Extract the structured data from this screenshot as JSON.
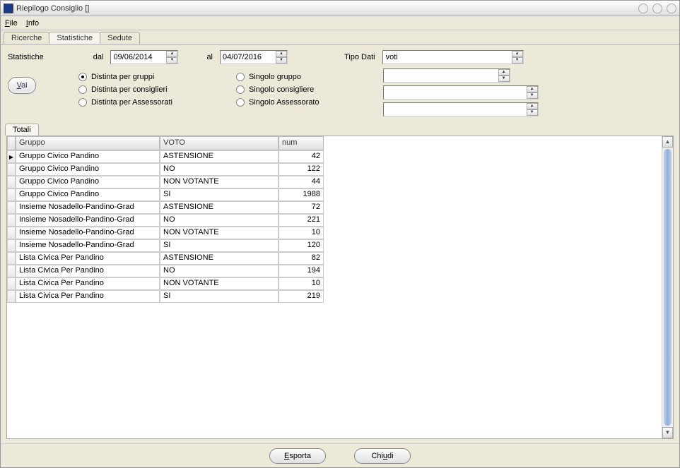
{
  "window": {
    "title": "Riepilogo Consiglio []"
  },
  "menu": {
    "file": "File",
    "info": "Info"
  },
  "mainTabs": {
    "ricerche": "Ricerche",
    "statistiche": "Statistiche",
    "sedute": "Sedute"
  },
  "filters": {
    "statLabel": "Statistiche",
    "dal": "dal",
    "dalValue": "09/06/2014",
    "al": "al",
    "alValue": "04/07/2016",
    "tipoDati": "Tipo Dati",
    "tipoDatiValue": "voti",
    "vai": "Vai",
    "radios": {
      "distGruppi": "Distinta per gruppi",
      "distCons": "Distinta per consiglieri",
      "distAss": "Distinta per Assessorati",
      "singGruppo": "Singolo gruppo",
      "singCons": "Singolo consigliere",
      "singAss": "Singolo Assessorato"
    }
  },
  "subTab": {
    "totali": "Totali"
  },
  "grid": {
    "headers": {
      "gruppo": "Gruppo",
      "voto": "VOTO",
      "num": "num"
    },
    "rows": [
      {
        "gruppo": "Gruppo Civico Pandino",
        "voto": "ASTENSIONE",
        "num": "42",
        "current": true
      },
      {
        "gruppo": "Gruppo Civico Pandino",
        "voto": "NO",
        "num": "122"
      },
      {
        "gruppo": "Gruppo Civico Pandino",
        "voto": "NON VOTANTE",
        "num": "44"
      },
      {
        "gruppo": "Gruppo Civico Pandino",
        "voto": "SI",
        "num": "1988"
      },
      {
        "gruppo": "Insieme Nosadello-Pandino-Grad",
        "voto": "ASTENSIONE",
        "num": "72"
      },
      {
        "gruppo": "Insieme Nosadello-Pandino-Grad",
        "voto": "NO",
        "num": "221"
      },
      {
        "gruppo": "Insieme Nosadello-Pandino-Grad",
        "voto": "NON VOTANTE",
        "num": "10"
      },
      {
        "gruppo": "Insieme Nosadello-Pandino-Grad",
        "voto": "SI",
        "num": "120"
      },
      {
        "gruppo": "Lista Civica Per Pandino",
        "voto": "ASTENSIONE",
        "num": "82"
      },
      {
        "gruppo": "Lista Civica Per Pandino",
        "voto": "NO",
        "num": "194"
      },
      {
        "gruppo": "Lista Civica Per Pandino",
        "voto": "NON VOTANTE",
        "num": "10"
      },
      {
        "gruppo": "Lista Civica Per Pandino",
        "voto": "SI",
        "num": "219"
      }
    ]
  },
  "footer": {
    "esporta": "Esporta",
    "chiudi": "Chiudi"
  }
}
